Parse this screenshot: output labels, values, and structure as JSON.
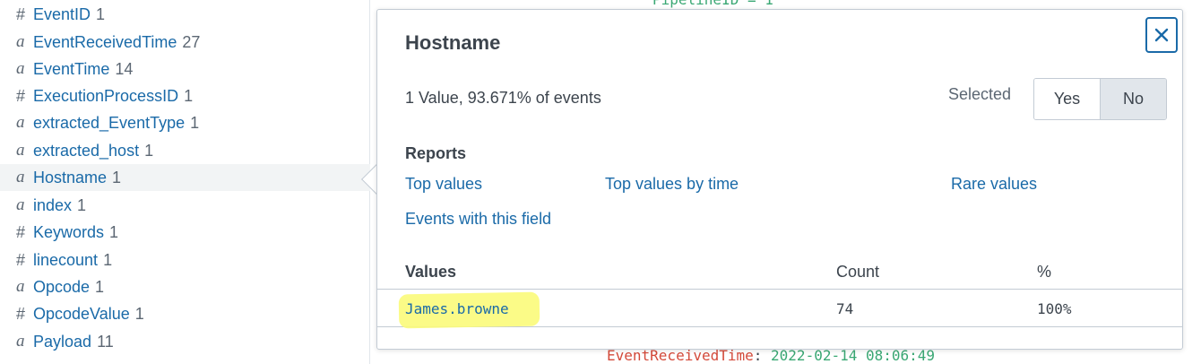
{
  "sidebar": {
    "fields": [
      {
        "type": "#",
        "name": "EventID",
        "count": "1"
      },
      {
        "type": "a",
        "name": "EventReceivedTime",
        "count": "27"
      },
      {
        "type": "a",
        "name": "EventTime",
        "count": "14"
      },
      {
        "type": "#",
        "name": "ExecutionProcessID",
        "count": "1"
      },
      {
        "type": "a",
        "name": "extracted_EventType",
        "count": "1"
      },
      {
        "type": "a",
        "name": "extracted_host",
        "count": "1"
      },
      {
        "type": "a",
        "name": "Hostname",
        "count": "1"
      },
      {
        "type": "a",
        "name": "index",
        "count": "1"
      },
      {
        "type": "#",
        "name": "Keywords",
        "count": "1"
      },
      {
        "type": "#",
        "name": "linecount",
        "count": "1"
      },
      {
        "type": "a",
        "name": "Opcode",
        "count": "1"
      },
      {
        "type": "#",
        "name": "OpcodeValue",
        "count": "1"
      },
      {
        "type": "a",
        "name": "Payload",
        "count": "11"
      }
    ]
  },
  "background": {
    "pipeline_text": "PipelineID = 1",
    "received_key": "EventReceivedTime",
    "received_sep": ": ",
    "received_value": "2022-02-14 08:06:49"
  },
  "popover": {
    "title": "Hostname",
    "summary": "1 Value, 93.671% of events",
    "selected_label": "Selected",
    "yes_label": "Yes",
    "no_label": "No",
    "reports_title": "Reports",
    "links": {
      "top_values": "Top values",
      "top_values_by_time": "Top values by time",
      "rare_values": "Rare values",
      "events_with_field": "Events with this field"
    },
    "table": {
      "headers": {
        "values": "Values",
        "count": "Count",
        "percent": "%"
      },
      "rows": [
        {
          "value": "James.browne",
          "count": "74",
          "percent": "100%"
        }
      ]
    }
  },
  "colors": {
    "link": "#1a6aa8",
    "highlight": "#fbfb7a",
    "toggle_selected": "#e1e6eb"
  },
  "icons": {
    "close": "close-icon"
  }
}
